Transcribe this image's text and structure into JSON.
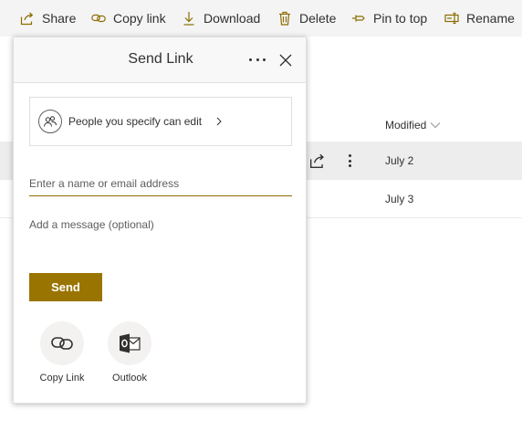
{
  "command_bar": {
    "items": [
      {
        "label": "Share",
        "icon": "share-icon"
      },
      {
        "label": "Copy link",
        "icon": "link-icon"
      },
      {
        "label": "Download",
        "icon": "download-icon"
      },
      {
        "label": "Delete",
        "icon": "trash-icon"
      },
      {
        "label": "Pin to top",
        "icon": "pin-icon"
      },
      {
        "label": "Rename",
        "icon": "rename-icon"
      }
    ]
  },
  "file_list": {
    "modified_header": "Modified",
    "rows": [
      {
        "modified": "July 2"
      },
      {
        "modified": "July 3"
      }
    ]
  },
  "dialog": {
    "title": "Send Link",
    "permission": "People you specify can edit",
    "recipient_placeholder": "Enter a name or email address",
    "message_placeholder": "Add a message (optional)",
    "send_label": "Send",
    "share_options": [
      {
        "label": "Copy Link",
        "icon": "link-icon"
      },
      {
        "label": "Outlook",
        "icon": "outlook-icon"
      }
    ]
  },
  "colors": {
    "accent": "#9a7400",
    "input_underline": "#8a6d00",
    "command_icon": "#8a6d00",
    "selected_row": "#ededed"
  }
}
